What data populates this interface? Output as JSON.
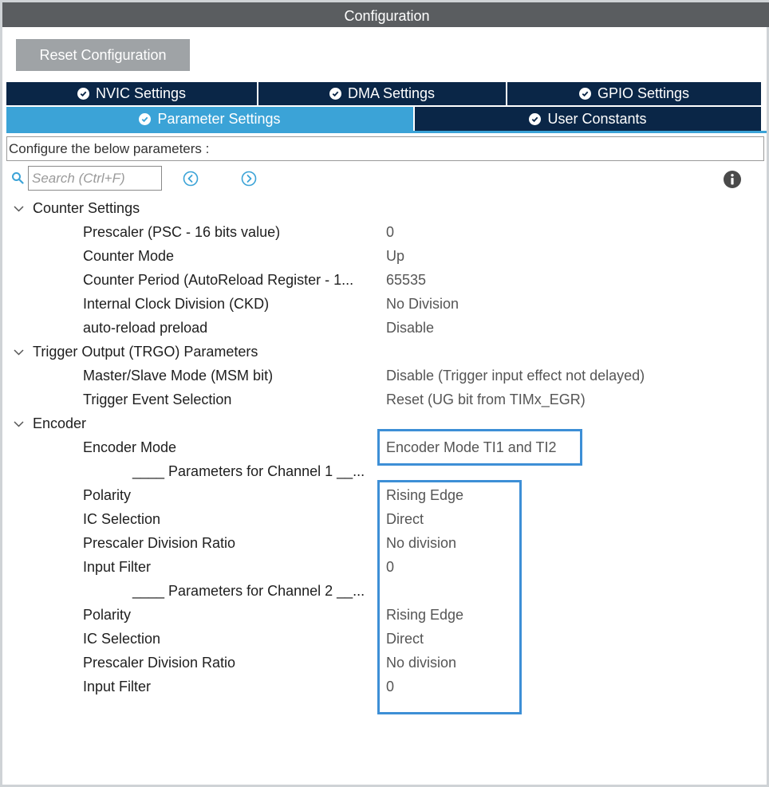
{
  "window": {
    "title": "Configuration"
  },
  "toolbar": {
    "reset_label": "Reset Configuration"
  },
  "tabs": {
    "row1": [
      {
        "label": "NVIC Settings"
      },
      {
        "label": "DMA Settings"
      },
      {
        "label": "GPIO Settings"
      }
    ],
    "row2": [
      {
        "label": "Parameter Settings",
        "active": true
      },
      {
        "label": "User Constants"
      }
    ]
  },
  "description": "Configure the below parameters :",
  "search": {
    "placeholder": "Search (Ctrl+F)",
    "value": ""
  },
  "icons": {
    "tab_status": "check-circle-icon",
    "search": "search-icon",
    "prev": "chevron-left-circle-icon",
    "next": "chevron-right-circle-icon",
    "info": "info-icon",
    "group_toggle": "chevron-down-icon"
  },
  "colors": {
    "titlebar": "#5a5d60",
    "tab_inactive": "#0a2647",
    "tab_active": "#3ba3d7",
    "highlight": "#3d8fd6",
    "reset_button": "#9fa3a6"
  },
  "groups": {
    "counter": {
      "title": "Counter Settings",
      "params": [
        {
          "label": "Prescaler (PSC - 16 bits value)",
          "value": "0"
        },
        {
          "label": "Counter Mode",
          "value": "Up"
        },
        {
          "label": "Counter Period (AutoReload Register - 1...",
          "value": "65535"
        },
        {
          "label": "Internal Clock Division (CKD)",
          "value": "No Division"
        },
        {
          "label": "auto-reload preload",
          "value": "Disable"
        }
      ]
    },
    "trgo": {
      "title": "Trigger Output (TRGO) Parameters",
      "params": [
        {
          "label": "Master/Slave Mode (MSM bit)",
          "value": "Disable (Trigger input effect not delayed)"
        },
        {
          "label": "Trigger Event Selection",
          "value": "Reset (UG bit from TIMx_EGR)"
        }
      ]
    },
    "encoder": {
      "title": "Encoder",
      "mode": {
        "label": "Encoder Mode",
        "value": "Encoder Mode TI1 and TI2"
      },
      "ch1_header": "____ Parameters for Channel 1 __...",
      "ch1": [
        {
          "label": "Polarity",
          "value": "Rising Edge"
        },
        {
          "label": "IC Selection",
          "value": "Direct"
        },
        {
          "label": "Prescaler Division Ratio",
          "value": "No division"
        },
        {
          "label": "Input Filter",
          "value": "0"
        }
      ],
      "ch2_header": "____ Parameters for Channel 2 __...",
      "ch2": [
        {
          "label": "Polarity",
          "value": "Rising Edge"
        },
        {
          "label": "IC Selection",
          "value": "Direct"
        },
        {
          "label": "Prescaler Division Ratio",
          "value": "No division"
        },
        {
          "label": "Input Filter",
          "value": "0"
        }
      ]
    }
  }
}
